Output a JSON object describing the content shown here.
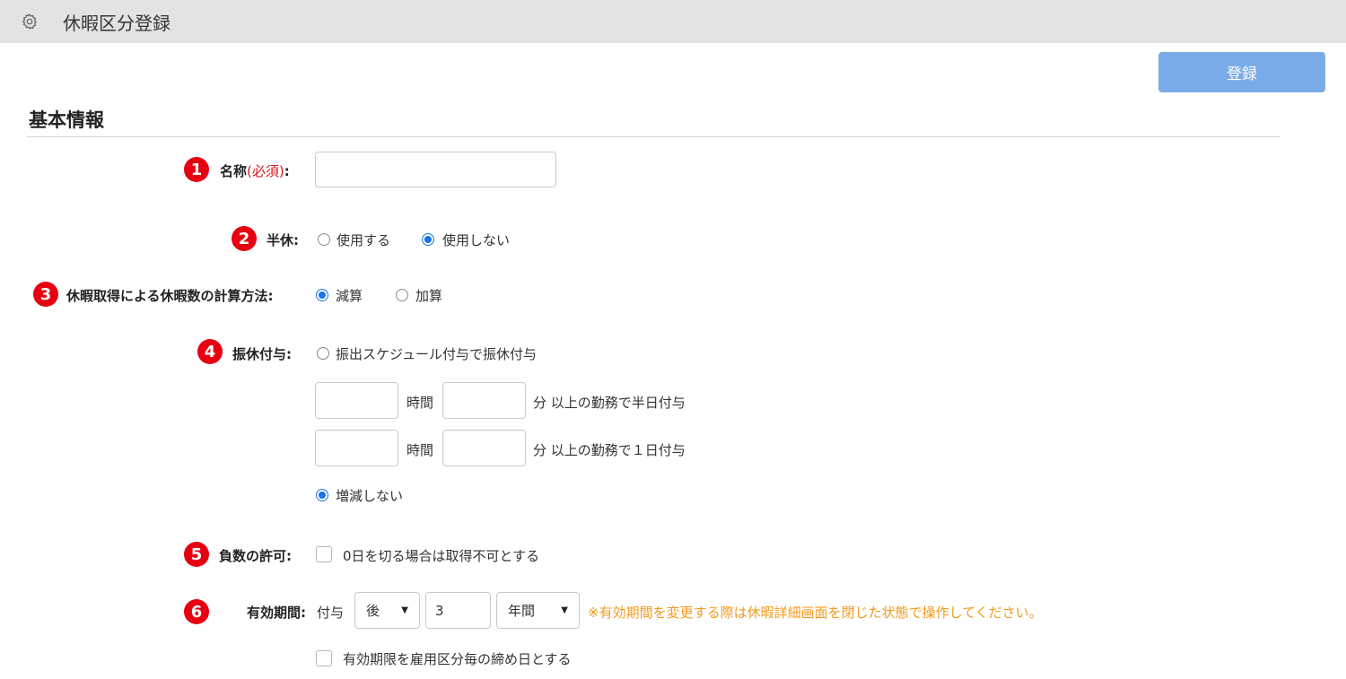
{
  "header": {
    "title": "休暇区分登録",
    "icon": "gear-icon"
  },
  "toolbar": {
    "register_label": "登録"
  },
  "section": {
    "title": "基本情報"
  },
  "badges": [
    "1",
    "2",
    "3",
    "4",
    "5",
    "6"
  ],
  "fields": {
    "name": {
      "label": "名称",
      "required": "(必須)",
      "colon": ":",
      "value": ""
    },
    "half_day": {
      "label": "半休:",
      "options": [
        "使用する",
        "使用しない"
      ],
      "selected": "使用しない"
    },
    "calc_method": {
      "label": "休暇取得による休暇数の計算方法:",
      "options": [
        "減算",
        "加算"
      ],
      "selected": "減算"
    },
    "substitute": {
      "label": "振休付与:",
      "option_schedule": "振出スケジュール付与で振休付与",
      "row1": {
        "hours_value": "",
        "hours_unit": "時間",
        "minutes_value": "",
        "suffix": "分 以上の勤務で半日付与"
      },
      "row2": {
        "hours_value": "",
        "hours_unit": "時間",
        "minutes_value": "",
        "suffix": "分 以上の勤務で１日付与"
      },
      "option_no_change": "増減しない",
      "selected": "増減しない"
    },
    "negative": {
      "label": "負数の許可:",
      "checkbox_label": "0日を切る場合は取得不可とする",
      "checked": false
    },
    "validity": {
      "label": "有効期間:",
      "prefix": "付与",
      "direction": "後",
      "amount": "3",
      "unit": "年間",
      "note": "※有効期間を変更する際は休暇詳細画面を閉じた状態で操作してください。",
      "checkbox_label": "有効期限を雇用区分毎の締め日とする",
      "checked": false
    }
  },
  "colors": {
    "accent": "#7aabe8",
    "badge": "#e60012",
    "required": "#d0191c",
    "note": "#f39a1e",
    "radio": "#1a73e8"
  }
}
